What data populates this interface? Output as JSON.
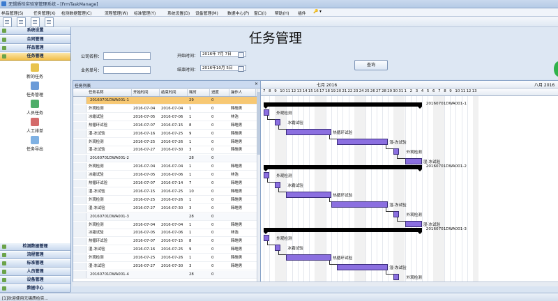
{
  "window": {
    "title": "无锡质检实验室管理系统 - [FrmTaskManage]"
  },
  "menu": [
    "样品管理(S)",
    "任务管理(X)",
    "检测数据管理(C)",
    "流程管理(W)",
    "标准管理(Y)",
    "系统设置(D)",
    "设备管理(M)",
    "数据中心(P)",
    "窗口(I)",
    "帮助(H)",
    "插件",
    "🔑 ▾"
  ],
  "sidebar": {
    "top_groups": [
      "系统设置",
      "合同管理",
      "样品管理",
      "任务管理"
    ],
    "items": [
      "新的任务",
      "任务管理",
      "人员任务",
      "人工排单",
      "任务导出"
    ],
    "bottom_groups": [
      "检测数据管理",
      "流程管理",
      "标准管理",
      "人员管理",
      "设备管理",
      "数据中心"
    ]
  },
  "form": {
    "title": "任务管理",
    "company_label": "公司名称：",
    "order_label": "业务单号：",
    "start_label": "开始时间：",
    "start_value": "2016年 7月 7日",
    "end_label": "结束时间：",
    "end_value": "2016年10月 5日",
    "query_button": "查询"
  },
  "list": {
    "tab_title": "任务列表",
    "close_glyph": "×",
    "columns": [
      "任务名称",
      "开始时间",
      "结束时间",
      "耗时",
      "进度",
      "操作人"
    ],
    "rows": [
      {
        "name": "20160701DWA001-1",
        "start": "",
        "end": "",
        "dur": "29",
        "prog": "0",
        "op": "",
        "group": true,
        "selected": true
      },
      {
        "name": "外观检测",
        "start": "2016-07-04",
        "end": "2016-07-04",
        "dur": "1",
        "prog": "0",
        "op": "韩皓男"
      },
      {
        "name": "冰霜试验",
        "start": "2016-07-05",
        "end": "2016-07-06",
        "dur": "1",
        "prog": "0",
        "op": "林浩"
      },
      {
        "name": "热循环试验",
        "start": "2016-07-07",
        "end": "2016-07-15",
        "dur": "8",
        "prog": "0",
        "op": "韩皓男"
      },
      {
        "name": "湿-冻试验",
        "start": "2016-07-16",
        "end": "2016-07-25",
        "dur": "9",
        "prog": "0",
        "op": "韩皓男"
      },
      {
        "name": "外观检测",
        "start": "2016-07-25",
        "end": "2016-07-26",
        "dur": "1",
        "prog": "0",
        "op": "韩皓男"
      },
      {
        "name": "湿-冻试验",
        "start": "2016-07-27",
        "end": "2016-07-30",
        "dur": "3",
        "prog": "0",
        "op": "韩皓男"
      },
      {
        "name": "20160701DWA001-2",
        "start": "",
        "end": "",
        "dur": "28",
        "prog": "0",
        "op": "",
        "group": true
      },
      {
        "name": "外观检测",
        "start": "2016-07-04",
        "end": "2016-07-04",
        "dur": "1",
        "prog": "0",
        "op": "韩皓男"
      },
      {
        "name": "冰霜试验",
        "start": "2016-07-05",
        "end": "2016-07-06",
        "dur": "1",
        "prog": "0",
        "op": "林浩"
      },
      {
        "name": "热循环试验",
        "start": "2016-07-07",
        "end": "2016-07-14",
        "dur": "7",
        "prog": "0",
        "op": "韩皓男"
      },
      {
        "name": "湿-冻试验",
        "start": "2016-07-15",
        "end": "2016-07-25",
        "dur": "10",
        "prog": "0",
        "op": "韩皓男"
      },
      {
        "name": "外观检测",
        "start": "2016-07-25",
        "end": "2016-07-26",
        "dur": "1",
        "prog": "0",
        "op": "韩皓男"
      },
      {
        "name": "湿-冻试验",
        "start": "2016-07-27",
        "end": "2016-07-30",
        "dur": "3",
        "prog": "0",
        "op": "韩皓男"
      },
      {
        "name": "20160701DWA001-3",
        "start": "",
        "end": "",
        "dur": "28",
        "prog": "0",
        "op": "",
        "group": true
      },
      {
        "name": "外观检测",
        "start": "2016-07-04",
        "end": "2016-07-04",
        "dur": "1",
        "prog": "0",
        "op": "韩皓男"
      },
      {
        "name": "冰霜试验",
        "start": "2016-07-05",
        "end": "2016-07-06",
        "dur": "1",
        "prog": "0",
        "op": "林浩"
      },
      {
        "name": "热循环试验",
        "start": "2016-07-07",
        "end": "2016-07-15",
        "dur": "8",
        "prog": "0",
        "op": "韩皓男"
      },
      {
        "name": "湿-冻试验",
        "start": "2016-07-16",
        "end": "2016-07-25",
        "dur": "9",
        "prog": "0",
        "op": "韩皓男"
      },
      {
        "name": "外观检测",
        "start": "2016-07-25",
        "end": "2016-07-26",
        "dur": "1",
        "prog": "0",
        "op": "韩皓男"
      },
      {
        "name": "湿-冻试验",
        "start": "2016-07-27",
        "end": "2016-07-30",
        "dur": "3",
        "prog": "0",
        "op": "韩皓男"
      },
      {
        "name": "20160701DWA001-4",
        "start": "",
        "end": "",
        "dur": "28",
        "prog": "0",
        "op": "",
        "group": true
      }
    ]
  },
  "gantt": {
    "months": [
      "七月 2016",
      "八月 2016"
    ],
    "days": [
      7,
      8,
      9,
      10,
      11,
      12,
      13,
      14,
      15,
      16,
      17,
      18,
      19,
      20,
      21,
      22,
      23,
      24,
      25,
      26,
      27,
      28,
      29,
      30,
      31,
      1,
      2,
      3,
      4,
      5,
      6,
      7,
      8,
      9,
      10,
      11,
      12,
      13
    ],
    "groups": [
      {
        "label": "20160701DWA001-1",
        "summary_start": 0,
        "summary_end": 28,
        "tasks": [
          {
            "name": "外观检测",
            "s": 0,
            "e": 1
          },
          {
            "name": "冰霜试验",
            "s": 2,
            "e": 3
          },
          {
            "name": "热循环试验",
            "s": 4,
            "e": 12
          },
          {
            "name": "湿-冻试验",
            "s": 13,
            "e": 22
          },
          {
            "name": "外观检测",
            "s": 23,
            "e": 24
          },
          {
            "name": "湿-冻试验",
            "s": 25,
            "e": 28
          }
        ]
      },
      {
        "label": "20160701DWA001-2",
        "summary_start": 0,
        "summary_end": 28,
        "tasks": [
          {
            "name": "外观检测",
            "s": 0,
            "e": 1
          },
          {
            "name": "冰霜试验",
            "s": 2,
            "e": 3
          },
          {
            "name": "热循环试验",
            "s": 4,
            "e": 12
          },
          {
            "name": "湿-冻试验",
            "s": 12,
            "e": 22
          },
          {
            "name": "外观检测",
            "s": 23,
            "e": 24
          },
          {
            "name": "湿-冻试验",
            "s": 25,
            "e": 28
          }
        ]
      },
      {
        "label": "20160701DWA001-3",
        "summary_start": 0,
        "summary_end": 28,
        "tasks": [
          {
            "name": "外观检测",
            "s": 0,
            "e": 1
          },
          {
            "name": "冰霜试验",
            "s": 2,
            "e": 3
          },
          {
            "name": "热循环试验",
            "s": 4,
            "e": 12
          },
          {
            "name": "湿-冻试验",
            "s": 13,
            "e": 22
          },
          {
            "name": "外观检测",
            "s": 23,
            "e": 24
          }
        ]
      }
    ]
  },
  "status": {
    "text": "[1]欢迎使用无锡质检实..."
  },
  "colors": {
    "bar": "#8b6fe0",
    "bar_border": "#3a2c7a",
    "summary": "#000000",
    "active_group": "#f2bf4c"
  }
}
